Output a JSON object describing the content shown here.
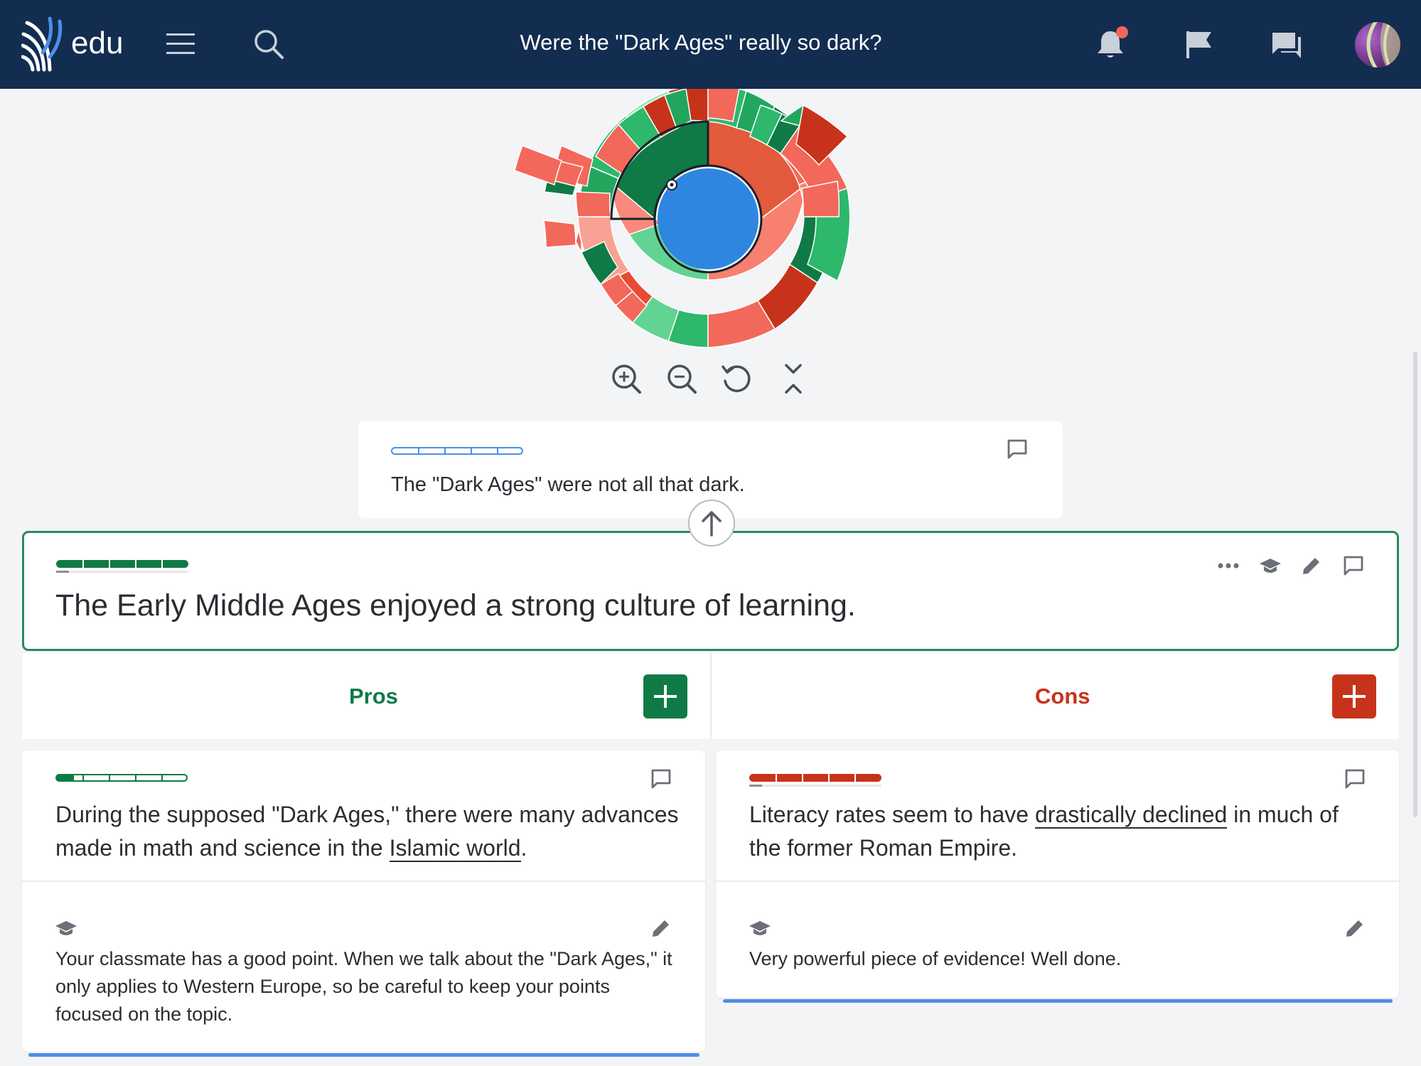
{
  "app": {
    "logo_text": "edu",
    "page_title": "Were the \"Dark Ages\" really so dark?"
  },
  "parent_claim": {
    "text": "The \"Dark Ages\" were not all that dark."
  },
  "focus_claim": {
    "text": "The Early Middle Ages enjoyed a strong culture of learning."
  },
  "columns": {
    "pros": {
      "title": "Pros",
      "color": "#0f7a45"
    },
    "cons": {
      "title": "Cons",
      "color": "#c7331a"
    }
  },
  "pro_card": {
    "text_before": "During the supposed \"Dark Ages,\" there were many advances made in math and science in the ",
    "link_text": "Islamic world",
    "text_after": ".",
    "feedback": "Your classmate has a good point. When we talk about the \"Dark Ages,\" it only applies to Western Europe, so be careful to keep your points focused on the topic."
  },
  "con_card": {
    "text_before": "Literacy rates seem to have ",
    "link_text": "drastically declined",
    "text_after": " in much of the former Roman Empire.",
    "feedback": "Very powerful piece of evidence! Well done."
  },
  "colors": {
    "header_bg": "#132d50",
    "accent_blue": "#2f86e0",
    "pro_green": "#0f7a45",
    "con_red": "#c7331a",
    "notification": "#f2675a"
  },
  "icons": {
    "header": [
      "menu-icon",
      "search-icon",
      "bell-icon",
      "flag-icon",
      "chat-icon"
    ],
    "zoom_controls": [
      "zoom-in-icon",
      "zoom-out-icon",
      "reset-icon",
      "collapse-icon"
    ],
    "card_actions": [
      "more-icon",
      "graduation-cap-icon",
      "pencil-icon",
      "comment-icon"
    ]
  }
}
